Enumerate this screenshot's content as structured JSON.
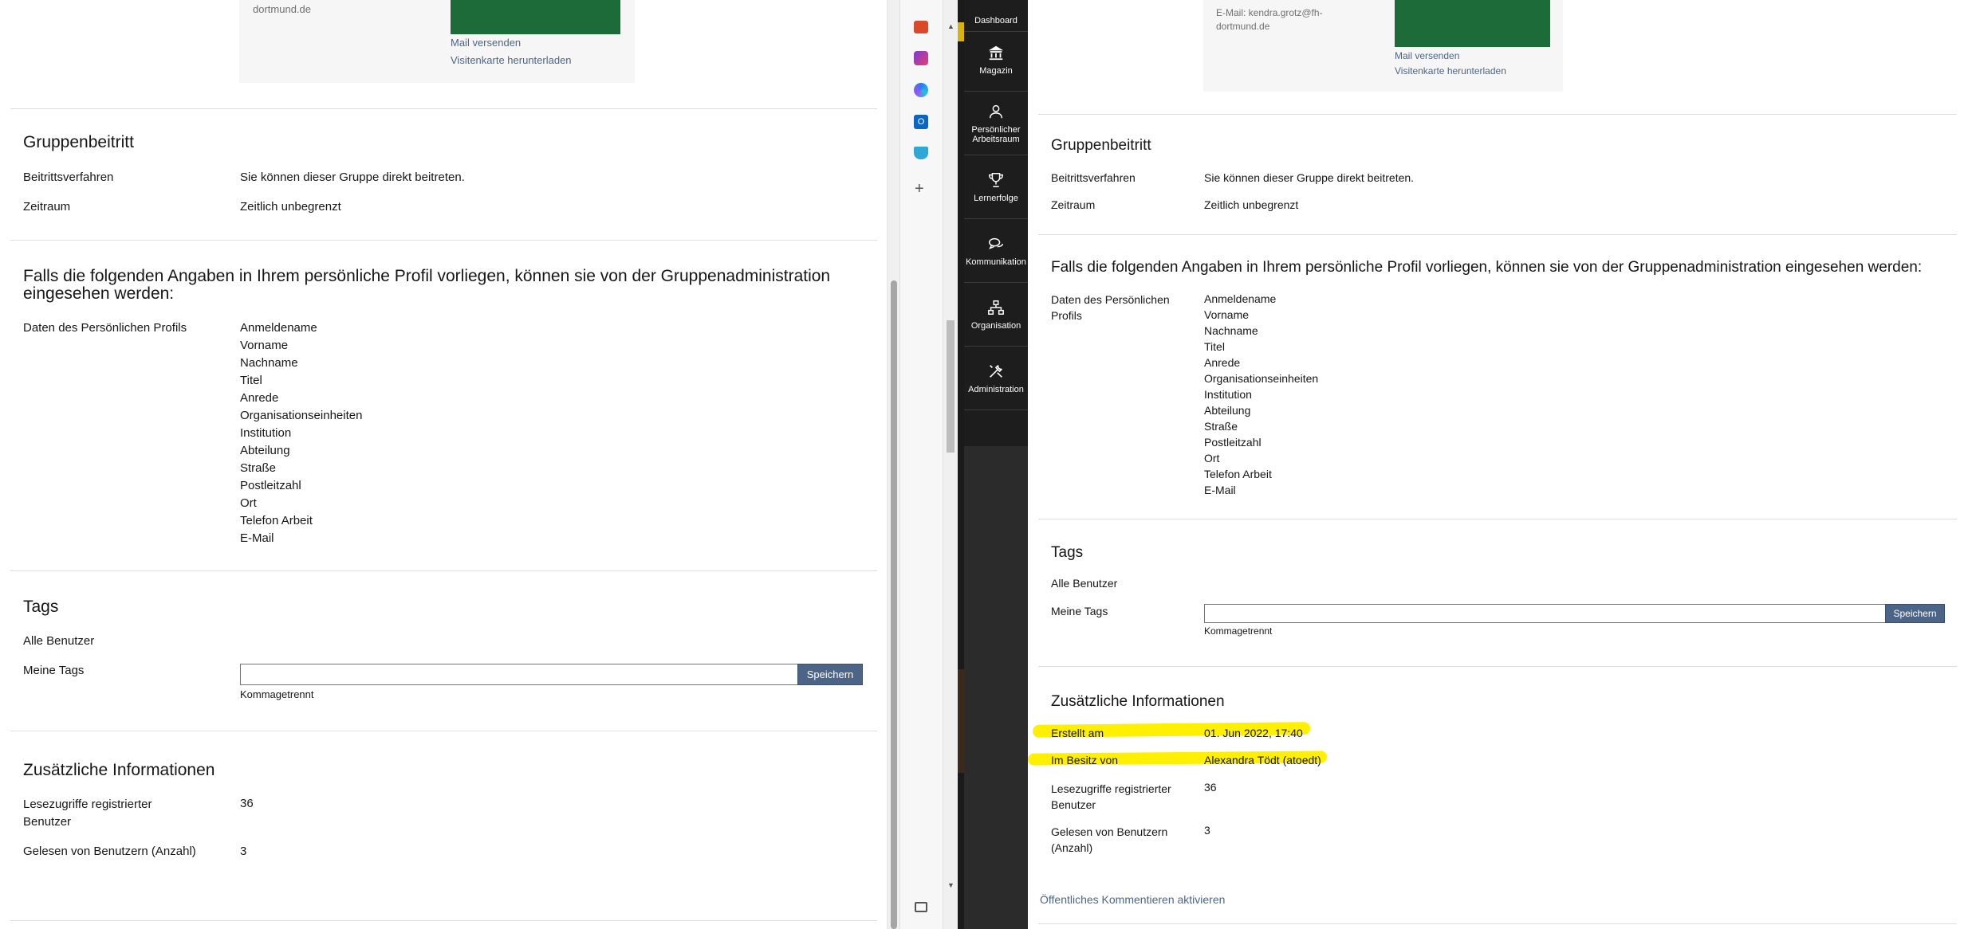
{
  "left": {
    "contact": {
      "email_tail": "dortmund.de",
      "mail_link": "Mail versenden",
      "vcard_link": "Visitenkarte herunterladen"
    },
    "group_join": {
      "title": "Gruppenbeitritt",
      "procedure_label": "Beitrittsverfahren",
      "procedure_value": "Sie können dieser Gruppe direkt beitreten.",
      "period_label": "Zeitraum",
      "period_value": "Zeitlich unbegrenzt"
    },
    "profile": {
      "title_line1": "Falls die folgenden Angaben in Ihrem persönliche Profil vorliegen, können sie von der Gruppenadministration",
      "title_line2": "eingesehen werden:",
      "label": "Daten des Persönlichen Profils",
      "fields": [
        "Anmeldename",
        "Vorname",
        "Nachname",
        "Titel",
        "Anrede",
        "Organisationseinheiten",
        "Institution",
        "Abteilung",
        "Straße",
        "Postleitzahl",
        "Ort",
        "Telefon Arbeit",
        "E-Mail"
      ]
    },
    "tags": {
      "title": "Tags",
      "all_users": "Alle Benutzer",
      "my_tags": "Meine Tags",
      "save": "Speichern",
      "hint": "Kommagetrennt",
      "input_value": ""
    },
    "info": {
      "title": "Zusätzliche Informationen",
      "reads_label_1": "Lesezugriffe registrierter",
      "reads_label_2": "Benutzer",
      "reads_value": "36",
      "readby_label": "Gelesen von Benutzern (Anzahl)",
      "readby_value": "3"
    }
  },
  "right": {
    "contact": {
      "email_line1": "E-Mail: kendra.grotz@fh-",
      "email_line2": "dortmund.de",
      "mail_link": "Mail versenden",
      "vcard_link": "Visitenkarte herunterladen"
    },
    "group_join": {
      "title": "Gruppenbeitritt",
      "procedure_label": "Beitrittsverfahren",
      "procedure_value": "Sie können dieser Gruppe direkt beitreten.",
      "period_label": "Zeitraum",
      "period_value": "Zeitlich unbegrenzt"
    },
    "profile": {
      "title": "Falls die folgenden Angaben in Ihrem persönliche Profil vorliegen, können sie von der Gruppenadministration eingesehen werden:",
      "label_1": "Daten des Persönlichen",
      "label_2": "Profils",
      "fields": [
        "Anmeldename",
        "Vorname",
        "Nachname",
        "Titel",
        "Anrede",
        "Organisationseinheiten",
        "Institution",
        "Abteilung",
        "Straße",
        "Postleitzahl",
        "Ort",
        "Telefon Arbeit",
        "E-Mail"
      ]
    },
    "tags": {
      "title": "Tags",
      "all_users": "Alle Benutzer",
      "my_tags": "Meine Tags",
      "save": "Speichern",
      "hint": "Kommagetrennt",
      "input_value": ""
    },
    "info": {
      "title": "Zusätzliche Informationen",
      "created_label": "Erstellt am",
      "created_value": "01. Jun 2022, 17:40",
      "owner_label": "Im Besitz von",
      "owner_value": "Alexandra Tödt (atoedt)",
      "reads_label_1": "Lesezugriffe registrierter",
      "reads_label_2": "Benutzer",
      "reads_value": "36",
      "readby_label_1": "Gelesen von Benutzern",
      "readby_label_2": "(Anzahl)",
      "readby_value": "3"
    },
    "comments_link": "Öffentliches Kommentieren aktivieren"
  },
  "mainbar": {
    "items": [
      {
        "label": "Dashboard",
        "icon": "dashboard-icon"
      },
      {
        "label": "Magazin",
        "icon": "bank-icon"
      },
      {
        "label": "Persönlicher Arbeitsraum",
        "icon": "person-icon"
      },
      {
        "label": "Lernerfolge",
        "icon": "trophy-icon"
      },
      {
        "label": "Kommunikation",
        "icon": "chat-bubbles-icon"
      },
      {
        "label": "Organisation",
        "icon": "org-chart-icon"
      },
      {
        "label": "Administration",
        "icon": "tools-icon"
      }
    ]
  },
  "colors": {
    "link": "#4c6586",
    "button": "#4c6586",
    "mainbar": "#1d1d1d",
    "highlight": "#ffef00",
    "contact_green": "#1e6b3a"
  }
}
